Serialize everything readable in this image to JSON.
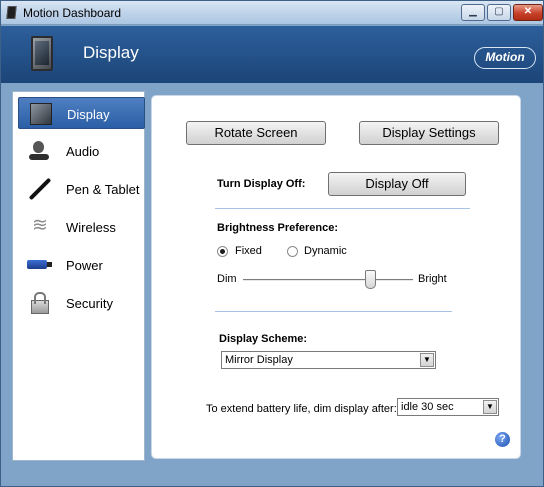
{
  "window": {
    "title": "Motion Dashboard"
  },
  "header": {
    "title": "Display",
    "brand": "Motion"
  },
  "sidebar": {
    "items": [
      {
        "label": "Display",
        "icon": "display-icon",
        "selected": true
      },
      {
        "label": "Audio",
        "icon": "audio-icon",
        "selected": false
      },
      {
        "label": "Pen & Tablet",
        "icon": "pen-icon",
        "selected": false
      },
      {
        "label": "Wireless",
        "icon": "wireless-icon",
        "selected": false
      },
      {
        "label": "Power",
        "icon": "power-icon",
        "selected": false
      },
      {
        "label": "Security",
        "icon": "security-icon",
        "selected": false
      }
    ]
  },
  "main": {
    "rotate_button": "Rotate Screen",
    "settings_button": "Display Settings",
    "turn_off_label": "Turn Display Off:",
    "display_off_button": "Display Off",
    "brightness": {
      "label": "Brightness Preference:",
      "options": [
        "Fixed",
        "Dynamic"
      ],
      "selected": "Fixed",
      "min_label": "Dim",
      "max_label": "Bright",
      "level_fraction": 0.75
    },
    "scheme": {
      "label": "Display Scheme:",
      "value": "Mirror Display"
    },
    "dim": {
      "label": "To extend battery life, dim display after:",
      "value": "idle 30 sec"
    },
    "help_glyph": "?"
  },
  "colors": {
    "accent": "#2a5ea6",
    "header_bg": "#1c4578",
    "frame": "#7fa4c8"
  }
}
